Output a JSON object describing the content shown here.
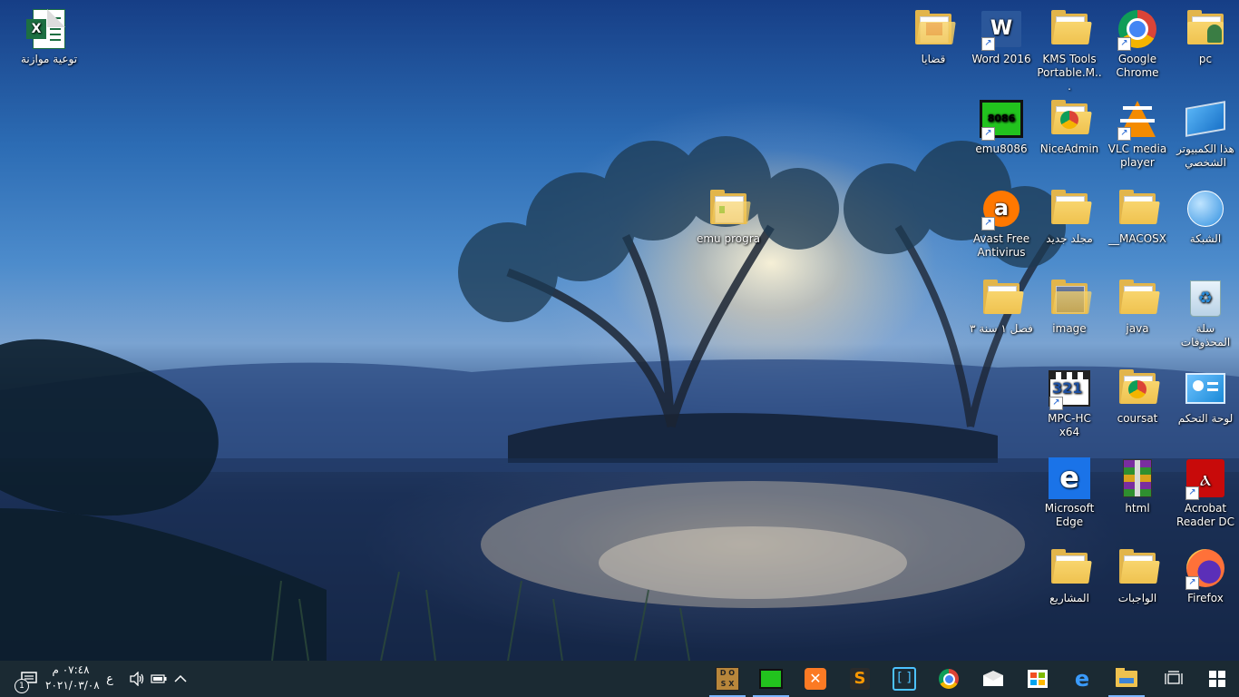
{
  "desktop": {
    "icons": [
      {
        "id": "excel",
        "label": "توعية موازنة"
      },
      {
        "id": "pc-folder",
        "label": "pc"
      },
      {
        "id": "chrome",
        "label": "Google Chrome"
      },
      {
        "id": "kms",
        "label": "KMS Tools Portable.M..."
      },
      {
        "id": "word",
        "label": "Word 2016"
      },
      {
        "id": "qadaya",
        "label": "قضايا"
      },
      {
        "id": "this-pc",
        "label": "هذا الكمبيوتر الشخصي"
      },
      {
        "id": "vlc",
        "label": "VLC media player"
      },
      {
        "id": "niceadmin",
        "label": "NiceAdmin"
      },
      {
        "id": "emu8086",
        "label": "emu8086"
      },
      {
        "id": "network",
        "label": "الشبكة"
      },
      {
        "id": "macosx",
        "label": "__MACOSX"
      },
      {
        "id": "new-folder",
        "label": "مجلد جديد"
      },
      {
        "id": "avast",
        "label": "Avast Free Antivirus"
      },
      {
        "id": "emu-progra",
        "label": "emu progra"
      },
      {
        "id": "recycle",
        "label": "سلة المحذوفات"
      },
      {
        "id": "java",
        "label": "java"
      },
      {
        "id": "image",
        "label": "image"
      },
      {
        "id": "fasl",
        "label": "فصل ١ سنة ٣"
      },
      {
        "id": "control-panel",
        "label": "لوحة التحكم"
      },
      {
        "id": "coursat",
        "label": "coursat"
      },
      {
        "id": "mpc",
        "label": "MPC-HC x64"
      },
      {
        "id": "acrobat",
        "label": "Acrobat Reader DC"
      },
      {
        "id": "html",
        "label": "html"
      },
      {
        "id": "edge",
        "label": "Microsoft Edge"
      },
      {
        "id": "firefox",
        "label": "Firefox"
      },
      {
        "id": "wajibat",
        "label": "الواجبات"
      },
      {
        "id": "mashari",
        "label": "المشاريع"
      }
    ]
  },
  "taskbar": {
    "time": "٠٧:٤٨ م",
    "date": "٢٠٢١/٠٣/٠٨",
    "language": "ع",
    "notification_count": "1",
    "pinned": [
      "dosbox-icon",
      "emu8086-icon",
      "xampp-icon",
      "sublime-icon",
      "app-icon",
      "chrome-icon",
      "mail-icon",
      "store-icon",
      "edge-icon",
      "file-explorer-icon",
      "task-view-icon",
      "start-icon"
    ]
  },
  "colors": {
    "taskbar": "#1b2a33",
    "accent": "#7cb4ff",
    "folder": "#efc24f"
  }
}
